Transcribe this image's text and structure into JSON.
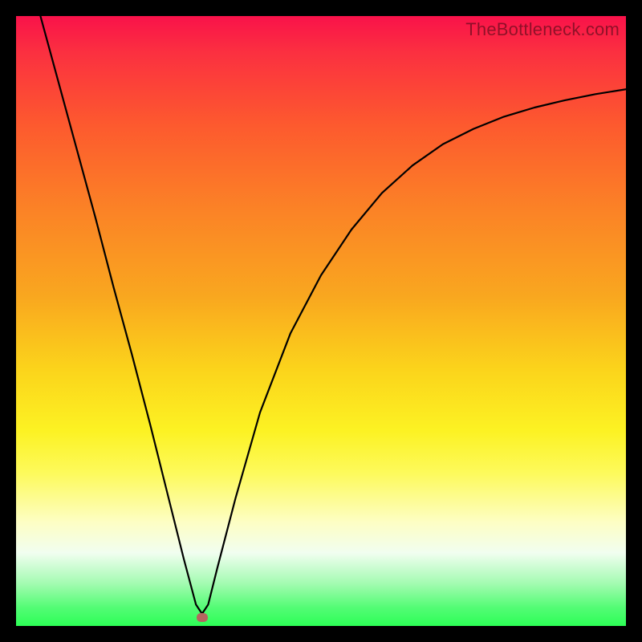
{
  "watermark": "TheBottleneck.com",
  "frame": {
    "border_color": "#000000",
    "background": "gradient"
  },
  "dot": {
    "x_frac": 0.305,
    "y_frac": 0.985,
    "color": "#b5655f"
  },
  "chart_data": {
    "type": "line",
    "title": "",
    "xlabel": "",
    "ylabel": "",
    "xlim": [
      0,
      1
    ],
    "ylim": [
      0,
      1
    ],
    "grid": false,
    "series": [
      {
        "name": "curve",
        "color": "#000000",
        "x": [
          0.04,
          0.07,
          0.1,
          0.13,
          0.16,
          0.19,
          0.22,
          0.25,
          0.275,
          0.295,
          0.305,
          0.315,
          0.33,
          0.36,
          0.4,
          0.45,
          0.5,
          0.55,
          0.6,
          0.65,
          0.7,
          0.75,
          0.8,
          0.85,
          0.9,
          0.95,
          1.0
        ],
        "y": [
          1.0,
          0.89,
          0.78,
          0.67,
          0.555,
          0.445,
          0.33,
          0.21,
          0.11,
          0.035,
          0.02,
          0.035,
          0.095,
          0.21,
          0.35,
          0.48,
          0.575,
          0.65,
          0.71,
          0.755,
          0.79,
          0.815,
          0.835,
          0.85,
          0.862,
          0.872,
          0.88
        ]
      }
    ],
    "annotations": [
      {
        "kind": "marker",
        "x": 0.305,
        "y": 0.015,
        "color": "#b5655f"
      }
    ],
    "background_gradient": {
      "stops": [
        {
          "pos": 0.0,
          "color": "#f9124a"
        },
        {
          "pos": 0.06,
          "color": "#fb3040"
        },
        {
          "pos": 0.18,
          "color": "#fd5a2e"
        },
        {
          "pos": 0.32,
          "color": "#fb8326"
        },
        {
          "pos": 0.46,
          "color": "#f9a71f"
        },
        {
          "pos": 0.58,
          "color": "#fbd41b"
        },
        {
          "pos": 0.68,
          "color": "#fcf223"
        },
        {
          "pos": 0.75,
          "color": "#fdfa5c"
        },
        {
          "pos": 0.83,
          "color": "#fdfec4"
        },
        {
          "pos": 0.88,
          "color": "#f1fef0"
        },
        {
          "pos": 0.93,
          "color": "#a4fbb2"
        },
        {
          "pos": 0.97,
          "color": "#53fc75"
        },
        {
          "pos": 1.0,
          "color": "#2dfe56"
        }
      ]
    }
  }
}
